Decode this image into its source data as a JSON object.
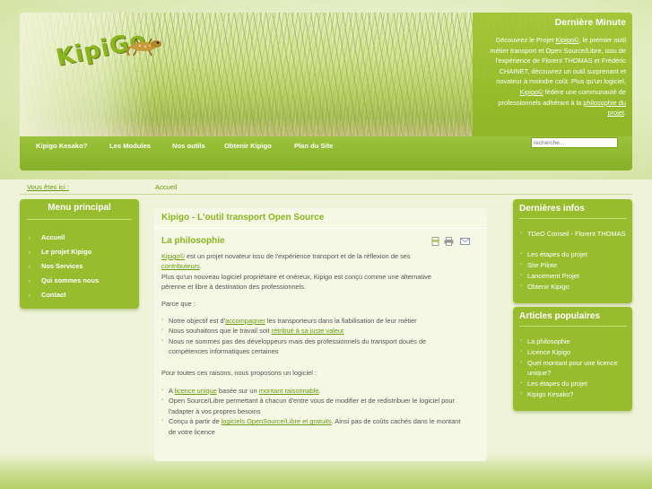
{
  "header": {
    "logo_text": "KipiGo",
    "minute": {
      "title": "Dernière Minute",
      "text_1": "Découvrez le Projet ",
      "link_1": "Kipigo©",
      "text_2": ", le premier outil métier transport et Open Source/Libre, issu de l'expérience de Florent THOMAS et Frédéric CHAINET, découvrez un outil surprenant et novateur à moindre coût. Plus qu'un logiciel, ",
      "link_2": "Kipigo©",
      "text_3": " fédère une communauté de professionnels adhérant à la ",
      "link_3": "philosophie du projet",
      "text_4": "."
    }
  },
  "nav": {
    "items": [
      "Kipigo Kesako?",
      "Les Modules",
      "Nos outils",
      "Obtenir Kipigo",
      "Plan du Site"
    ],
    "search_placeholder": "recherche..."
  },
  "breadcrumb": {
    "label": "Vous êtes ici :",
    "home": "Accueil"
  },
  "left_menu": {
    "title": "Menu principal",
    "items": [
      "Accueil",
      "Le projet Kipigo",
      "Nos Services",
      "Qui sommes nous",
      "Contact"
    ]
  },
  "content": {
    "title": "Kipigo - L'outil transport Open Source",
    "section_title": "La philosophie",
    "p1_link": "Kipigo©",
    "p1_text": " est un projet novateur issu de l'expérience transport et de la réflexion de ses",
    "p1_link2": "contributeurs",
    "p1_end": ".",
    "p2": "Plus qu'un nouveau logiciel propriétaire et onéreux, Kipigo est conçu comme une alternative pérenne et libre à destination des professionnels.",
    "p3": "Parce que :",
    "bullets_1": [
      {
        "a": "Notre objectif est d'",
        "link": "accompagner",
        "b": " les transporteurs dans la fiabilisation de leur métier"
      },
      {
        "a": "Nous souhaitons que le travail soit ",
        "link": "rétribué à sa juste valeur",
        "b": ""
      },
      {
        "a": "Nous ne sommes pas des développeurs mais des professionnels du transport doués de compétences informatiques certaines",
        "link": "",
        "b": ""
      }
    ],
    "p4": "Pour toutes ces raisons, nous proposons un logiciel :",
    "bullets_2": [
      {
        "a": "A ",
        "link": "licence unique",
        "b": " basée sur un ",
        "link2": "montant raisonnable",
        "c": "."
      },
      {
        "a": "Open Source/Libre permettant à chacun d'entre vous de modifier et de redistribuer le logiciel pour l'adapter à vos propres besoins",
        "link": "",
        "b": "",
        "link2": "",
        "c": ""
      },
      {
        "a": "Conçu à partir de ",
        "link": "logiciels OpenSource/Libre et gratuits",
        "b": ". Ainsi pas de coûts cachés dans le montant de votre licence",
        "link2": "",
        "c": ""
      }
    ]
  },
  "right_news": {
    "title": "Dernières infos",
    "items": [
      "TDeO Conseil - Florent THOMAS",
      "Les étapes du projet",
      "Site Pilote",
      "Lancement Projet",
      "Obtenir Kipigo"
    ]
  },
  "right_popular": {
    "title": "Articles populaires",
    "items": [
      "La philosophie",
      "Licence Kipigo",
      "Quel montant pour une licence unique?",
      "Les étapes du projet",
      "Kipigo Kesako?"
    ]
  },
  "icons": {
    "print": "print-icon",
    "pdf": "pdf-icon",
    "email": "email-icon",
    "chevron": "chevron-right-icon"
  },
  "colors": {
    "accent": "#8ab420",
    "panel": "#97bd2f",
    "link": "#6a9a12"
  }
}
